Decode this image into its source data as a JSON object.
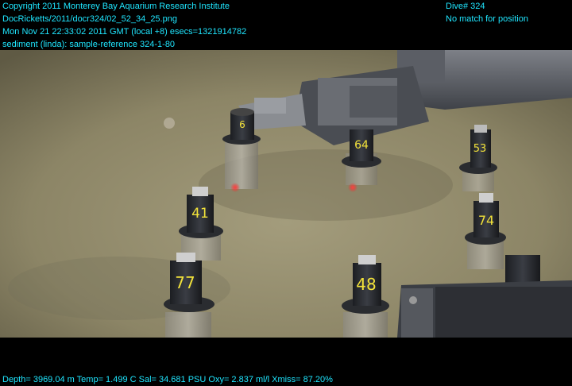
{
  "header_left": [
    "Copyright 2011 Monterey Bay Aquarium Research Institute",
    "DocRicketts/2011/docr324/02_52_34_25.png",
    "Mon Nov 21 22:33:02 2011 GMT (local +8)  esecs=1321914782",
    "sediment (linda): sample-reference 324-1-80"
  ],
  "header_right": [
    "Dive# 324",
    "No match for position"
  ],
  "footer": "Depth= 3969.04 m  Temp= 1.499 C  Sal= 34.681 PSU  Oxy= 2.837 ml/l  Xmiss= 87.20%",
  "core_labels": [
    "6",
    "64",
    "53",
    "41",
    "74",
    "77",
    "48"
  ],
  "colors": {
    "overlay_text": "#1fe6ff",
    "sediment": "#8f8868",
    "core_body": "#2d3036",
    "label_yellow": "#f2e23a",
    "laser": "#ff2020"
  }
}
